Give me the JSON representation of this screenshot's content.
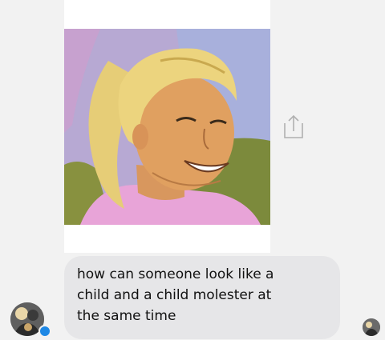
{
  "message": {
    "text": "how can someone look like a\nchild and a child molester at\nthe same time"
  },
  "icons": {
    "share": "share-icon",
    "messenger_badge": "messenger-badge-icon"
  },
  "colors": {
    "bubble": "#e6e6e8",
    "background": "#f2f2f2",
    "badge": "#1e88e5"
  }
}
